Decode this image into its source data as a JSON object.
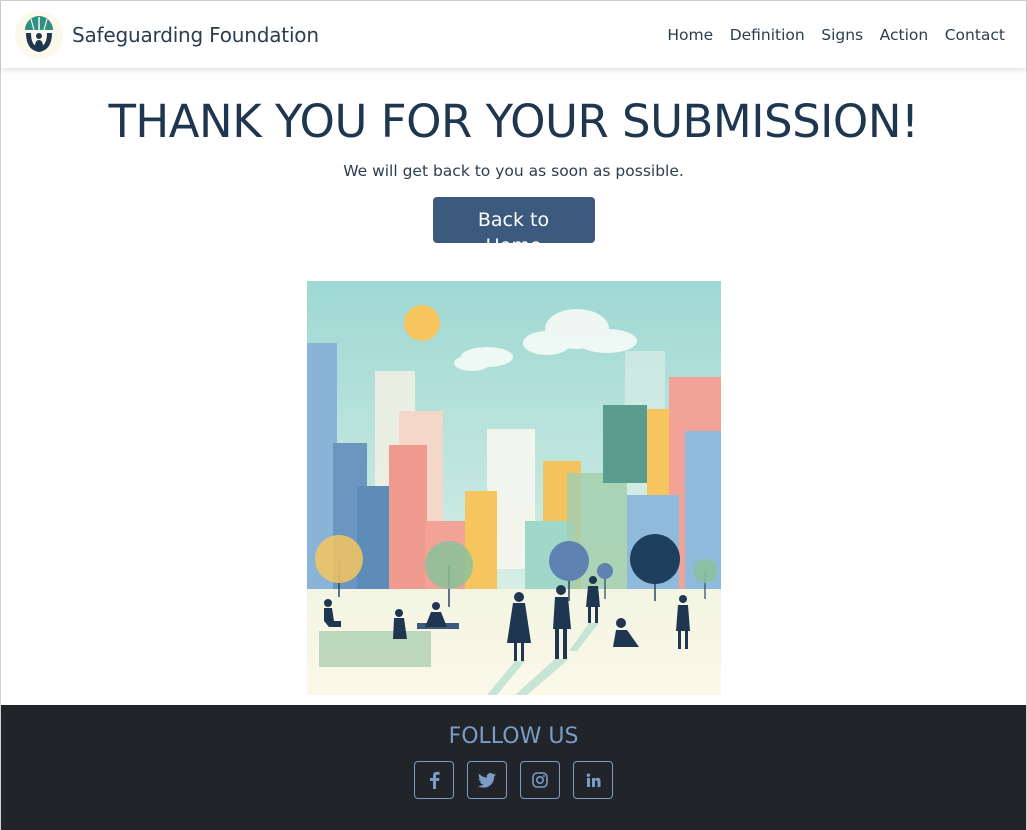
{
  "brand": {
    "name": "Safeguarding Foundation"
  },
  "nav": {
    "items": [
      {
        "label": "Home"
      },
      {
        "label": "Definition"
      },
      {
        "label": "Signs"
      },
      {
        "label": "Action"
      },
      {
        "label": "Contact"
      }
    ]
  },
  "main": {
    "headline": "THANK YOU FOR YOUR SUBMISSION!",
    "subtext": "We will get back to you as soon as possible.",
    "back_button_label": "Back to Home"
  },
  "footer": {
    "heading": "FOLLOW US",
    "socials": [
      {
        "icon": "facebook-icon"
      },
      {
        "icon": "twitter-icon"
      },
      {
        "icon": "instagram-icon"
      },
      {
        "icon": "linkedin-icon"
      }
    ]
  },
  "colors": {
    "primary": "#3b5a7d",
    "heading": "#1f3650",
    "footer_bg": "#212529",
    "footer_accent": "#7a9cc6"
  }
}
